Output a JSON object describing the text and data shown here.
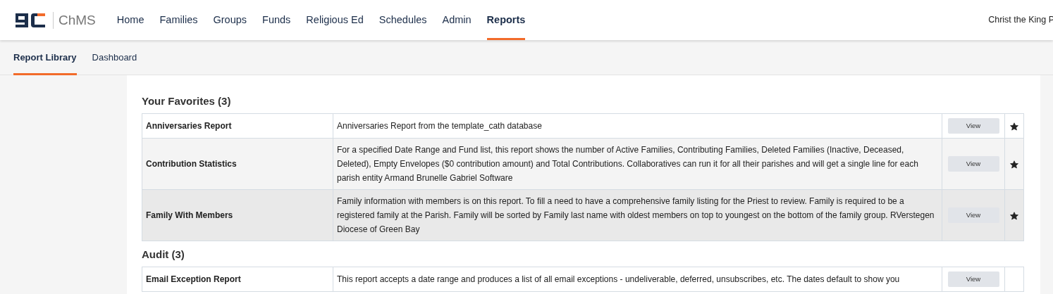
{
  "app": {
    "product": "ChMS",
    "parish": "Christ the King P"
  },
  "nav": [
    {
      "label": "Home",
      "selected": false
    },
    {
      "label": "Families",
      "selected": false
    },
    {
      "label": "Groups",
      "selected": false
    },
    {
      "label": "Funds",
      "selected": false
    },
    {
      "label": "Religious Ed",
      "selected": false
    },
    {
      "label": "Schedules",
      "selected": false
    },
    {
      "label": "Admin",
      "selected": false
    },
    {
      "label": "Reports",
      "selected": true
    }
  ],
  "subnav": [
    {
      "label": "Report Library",
      "selected": true
    },
    {
      "label": "Dashboard",
      "selected": false
    }
  ],
  "sections": [
    {
      "title": "Your Favorites (3)",
      "rows": [
        {
          "name": "Anniversaries Report",
          "description": "Anniversaries Report from the template_cath database",
          "button": "View",
          "favorite": true,
          "highlighted": false
        },
        {
          "name": "Contribution Statistics",
          "description": "For a specified Date Range and Fund list, this report shows the number of Active Families, Contributing Families, Deleted Families (Inactive, Deceased, Deleted), Empty Envelopes ($0 contribution amount) and Total Contributions. Collaboratives can run it for all their parishes and will get a single line for each parish entity Armand Brunelle Gabriel Software",
          "button": "View",
          "favorite": true,
          "highlighted": false
        },
        {
          "name": "Family With Members",
          "description": "Family information with members is on this report. To fill a need to have a comprehensive family listing for the Priest to review. Family is required to be a registered family at the Parish. Family will be sorted by Family last name with oldest members on top to youngest on the bottom of the family group. RVerstegen Diocese of Green Bay",
          "button": "View",
          "favorite": true,
          "highlighted": true
        }
      ]
    },
    {
      "title": "Audit (3)",
      "rows": [
        {
          "name": "Email Exception Report",
          "description": "This report accepts a date range and produces a list of all email exceptions - undeliverable, deferred, unsubscribes, etc. The dates default to show you",
          "button": "View",
          "highlighted": false
        }
      ]
    }
  ]
}
